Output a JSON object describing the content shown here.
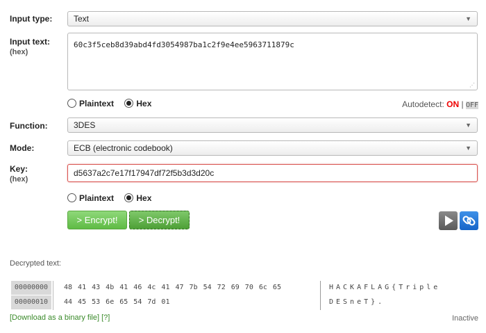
{
  "input_type": {
    "label": "Input type:",
    "value": "Text"
  },
  "input_text": {
    "label": "Input text:",
    "sub": "(hex)",
    "value": "60c3f5ceb8d39abd4fd3054987ba1c2f9e4ee5963711879c"
  },
  "input_format": {
    "plaintext": "Plaintext",
    "hex": "Hex",
    "selected": "hex"
  },
  "autodetect": {
    "label": "Autodetect:",
    "on": "ON",
    "sep": "|",
    "off": "OFF"
  },
  "function": {
    "label": "Function:",
    "value": "3DES"
  },
  "mode": {
    "label": "Mode:",
    "value": "ECB (electronic codebook)"
  },
  "key": {
    "label": "Key:",
    "sub": "(hex)",
    "value": "d5637a2c7e17f17947df72f5b3d3d20c"
  },
  "key_format": {
    "plaintext": "Plaintext",
    "hex": "Hex",
    "selected": "hex"
  },
  "buttons": {
    "encrypt": "> Encrypt!",
    "decrypt": "> Decrypt!"
  },
  "output": {
    "title": "Decrypted text:",
    "rows": [
      {
        "offset": "00000000",
        "hex": "48 41 43 4b 41 46 4c 41 47 7b 54 72 69 70 6c 65",
        "ascii": "HACKAFLAG{Triple"
      },
      {
        "offset": "00000010",
        "hex": "44 45 53 6e 65 54 7d 01",
        "ascii": "DESneT}."
      }
    ],
    "download_link": "[Download as a binary file]",
    "help_link": "[?]",
    "status": "Inactive"
  },
  "colors": {
    "accent_green": "#5fbb45",
    "autodetect_on": "#e00000",
    "link_blue": "#1765c8",
    "key_border": "#d9534f"
  }
}
